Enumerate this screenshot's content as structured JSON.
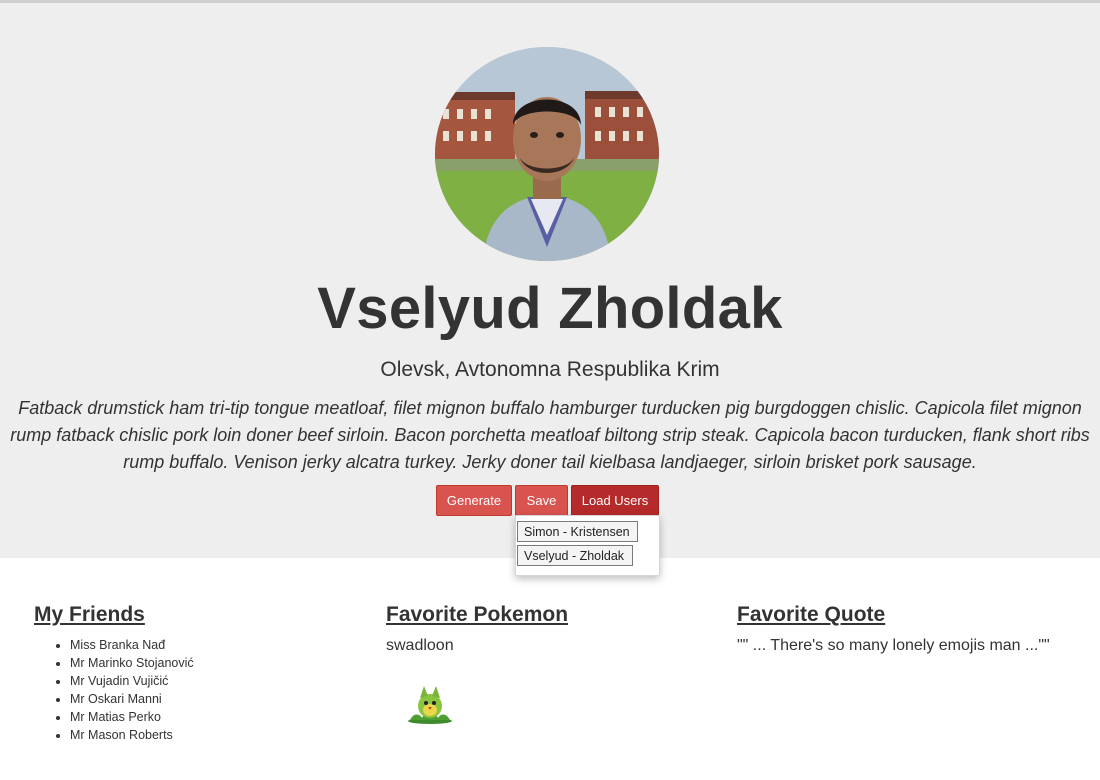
{
  "profile": {
    "name": "Vselyud Zholdak",
    "location": "Olevsk, Avtonomna Respublika Krim",
    "bio": "Fatback drumstick ham tri-tip tongue meatloaf, filet mignon buffalo hamburger turducken pig burgdoggen chislic. Capicola filet mignon rump fatback chislic pork loin doner beef sirloin. Bacon porchetta meatloaf biltong strip steak. Capicola bacon turducken, flank short ribs rump buffalo. Venison jerky alcatra turkey. Jerky doner tail kielbasa landjaeger, sirloin brisket pork sausage."
  },
  "actions": {
    "generate_label": "Generate",
    "save_label": "Save",
    "load_users_label": "Load Users"
  },
  "users_dropdown": {
    "items": [
      "Simon - Kristensen",
      "Vselyud - Zholdak"
    ]
  },
  "friends": {
    "title": "My Friends",
    "items": [
      "Miss Branka Nađ",
      "Mr Marinko Stojanović",
      "Mr Vujadin Vujičić",
      "Mr Oskari Manni",
      "Mr Matias Perko",
      "Mr Mason Roberts"
    ]
  },
  "pokemon": {
    "title": "Favorite Pokemon",
    "name": "swadloon"
  },
  "quote": {
    "title": "Favorite Quote",
    "text": "\"\" ... There's so many lonely emojis man ...\"\""
  },
  "colors": {
    "hero_background": "#eeeeee",
    "button_red": "#d9534f",
    "button_dark_red": "#b52a2a",
    "text": "#333333"
  }
}
